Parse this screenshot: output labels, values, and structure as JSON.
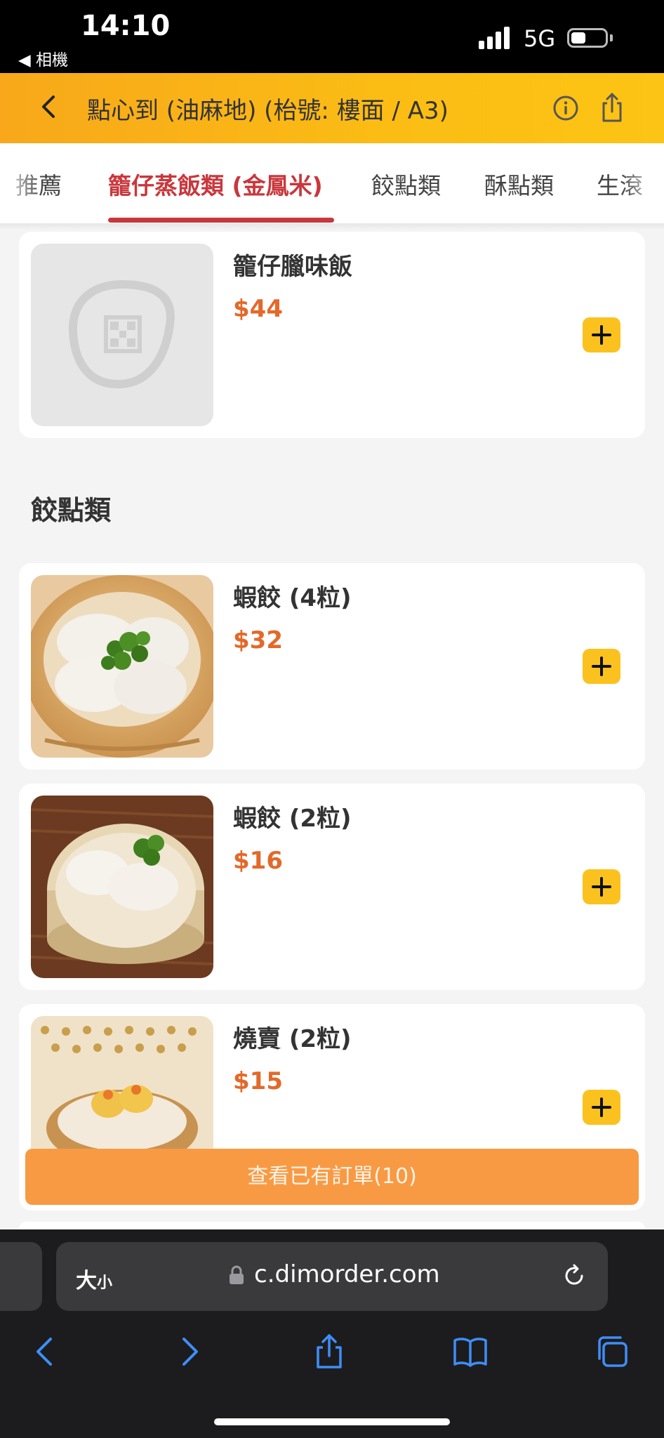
{
  "status_bar": {
    "time": "14:10",
    "back_app": "◀ 相機",
    "network": "5G"
  },
  "header": {
    "title": "點心到 (油麻地) (枱號: 樓面 / A3)"
  },
  "tabs": [
    {
      "label": "推薦"
    },
    {
      "label": "籠仔蒸飯類 (金鳳米)",
      "active": true
    },
    {
      "label": "餃點類"
    },
    {
      "label": "酥點類"
    },
    {
      "label": "生滾"
    }
  ],
  "items": [
    {
      "name": "籠仔臘味飯",
      "price": "$44",
      "image": "placeholder-logo-icon"
    },
    {
      "name": "蝦餃 (4粒)",
      "price": "$32",
      "image": "shrimp-dumplings-4"
    },
    {
      "name": "蝦餃 (2粒)",
      "price": "$16",
      "image": "shrimp-dumplings-2"
    },
    {
      "name": "燒賣 (2粒)",
      "price": "$15",
      "image": "siu-mai"
    }
  ],
  "section": {
    "title": "餃點類"
  },
  "order_bar": {
    "label": "查看已有訂單(10)"
  },
  "browser": {
    "text_size_big": "大",
    "text_size_small": "小",
    "url": "c.dimorder.com"
  },
  "colors": {
    "accent": "#fbc21f",
    "active_tab": "#c9373c",
    "price": "#e3692a",
    "order_bar": "#f89a44"
  }
}
